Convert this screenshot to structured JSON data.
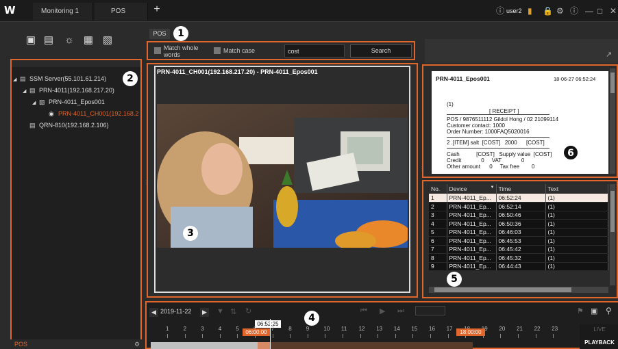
{
  "app": {
    "logo": "W"
  },
  "tabs": [
    {
      "label": "Monitoring 1"
    },
    {
      "label": "POS"
    }
  ],
  "topbar": {
    "user": "user2",
    "add_tab": "+"
  },
  "pos_tab_label": "POS",
  "search": {
    "match_whole_words": "Match whole words",
    "match_case": "Match case",
    "query": "cost",
    "button": "Search"
  },
  "tree": {
    "server": "SSM Server(55.101.61.214)",
    "nvr": "PRN-4011(192.168.217.20)",
    "pos": "PRN-4011_Epos001",
    "channel": "PRN-4011_CH001(192.168.2",
    "device2": "QRN-810(192.168.2.106)"
  },
  "left_footer": "POS",
  "video": {
    "title": "PRN-4011_CH001(192.168.217.20) - PRN-4011_Epos001"
  },
  "receipt": {
    "header_name": "PRN-4011_Epos001",
    "header_time": "18-06-27 06:52:24",
    "lines": [
      "(1)",
      "[ RECEIPT ]",
      "POS / 9876511112 Gildol Hong / 02  21099114",
      "Customer contact: 1000",
      "Order Number: 1000FAQ5020016",
      "2 .[ITEM] salt  [COST]   2000      [COST]",
      "Cash           [COST]   Supply value  [COST]",
      "Credit             0     VAT             0",
      "Other amount      0     Tax free        0"
    ]
  },
  "log": {
    "columns": [
      "No.",
      "Device",
      "Time",
      "Text"
    ],
    "rows": [
      {
        "no": "1",
        "device": "PRN-4011_Ep...",
        "time": "06:52:24",
        "text": "(1)"
      },
      {
        "no": "2",
        "device": "PRN-4011_Ep...",
        "time": "06:52:14",
        "text": "(1)"
      },
      {
        "no": "3",
        "device": "PRN-4011_Ep...",
        "time": "06:50:46",
        "text": "(1)"
      },
      {
        "no": "4",
        "device": "PRN-4011_Ep...",
        "time": "06:50:36",
        "text": "(1)"
      },
      {
        "no": "5",
        "device": "PRN-4011_Ep...",
        "time": "06:46:03",
        "text": "(1)"
      },
      {
        "no": "6",
        "device": "PRN-4011_Ep...",
        "time": "06:45:53",
        "text": "(1)"
      },
      {
        "no": "7",
        "device": "PRN-4011_Ep...",
        "time": "06:45:42",
        "text": "(1)"
      },
      {
        "no": "8",
        "device": "PRN-4011_Ep...",
        "time": "06:45:32",
        "text": "(1)"
      },
      {
        "no": "9",
        "device": "PRN-4011_Ep...",
        "time": "06:44:43",
        "text": "(1)"
      }
    ]
  },
  "timeline": {
    "date": "2019-11-22",
    "cursor_time": "06:52:25",
    "range_start": "06:00:00",
    "range_end": "18:00:00",
    "hours": [
      "1",
      "2",
      "3",
      "4",
      "5",
      "6",
      "7",
      "8",
      "9",
      "10",
      "11",
      "12",
      "13",
      "14",
      "15",
      "16",
      "17",
      "18",
      "19",
      "20",
      "21",
      "22",
      "23"
    ],
    "live": "LIVE",
    "playback": "PLAYBACK"
  },
  "badges": [
    "1",
    "2",
    "3",
    "4",
    "5",
    "6"
  ],
  "colors": {
    "accent": "#e0662c"
  }
}
